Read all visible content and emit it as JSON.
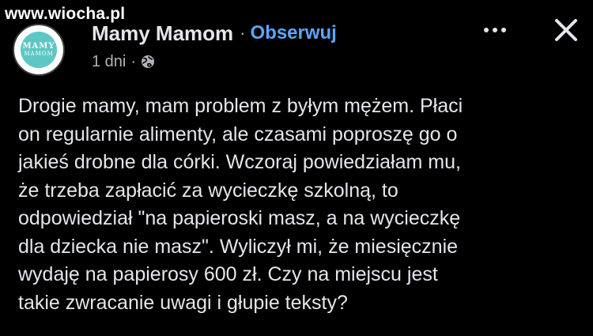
{
  "watermark": "www.wiocha.pl",
  "page": {
    "avatar_line1": "MAMY",
    "avatar_line2": "MAMOM",
    "name": "Mamy Mamom",
    "separator": "·",
    "follow_label": "Obserwuj",
    "time": "1 dni",
    "meta_separator": "·",
    "audience_icon": "globe-icon"
  },
  "actions": {
    "more_icon": "more-options-icon",
    "close_icon": "close-icon"
  },
  "post": {
    "lines": [
      "Drogie mamy, mam problem z byłym mężem.  Płaci",
      "on regularnie alimenty, ale czasami poproszę go o",
      "jakieś drobne dla córki. Wczoraj powiedziałam mu,",
      "że trzeba zapłacić za wycieczkę szkolną, to",
      "odpowiedział \"na papieroski masz, a na wycieczkę",
      "dla dziecka nie masz\". Wyliczył mi, że miesięcznie",
      "wydaję na papierosy 600 zł. Czy na miejscu jest",
      "takie zwracanie uwagi i głupie teksty?"
    ]
  },
  "colors": {
    "background": "#000000",
    "text": "#e4e6eb",
    "secondary_text": "#b0b3b8",
    "link": "#5aa7ff",
    "avatar_accent": "#5ec7c4"
  }
}
